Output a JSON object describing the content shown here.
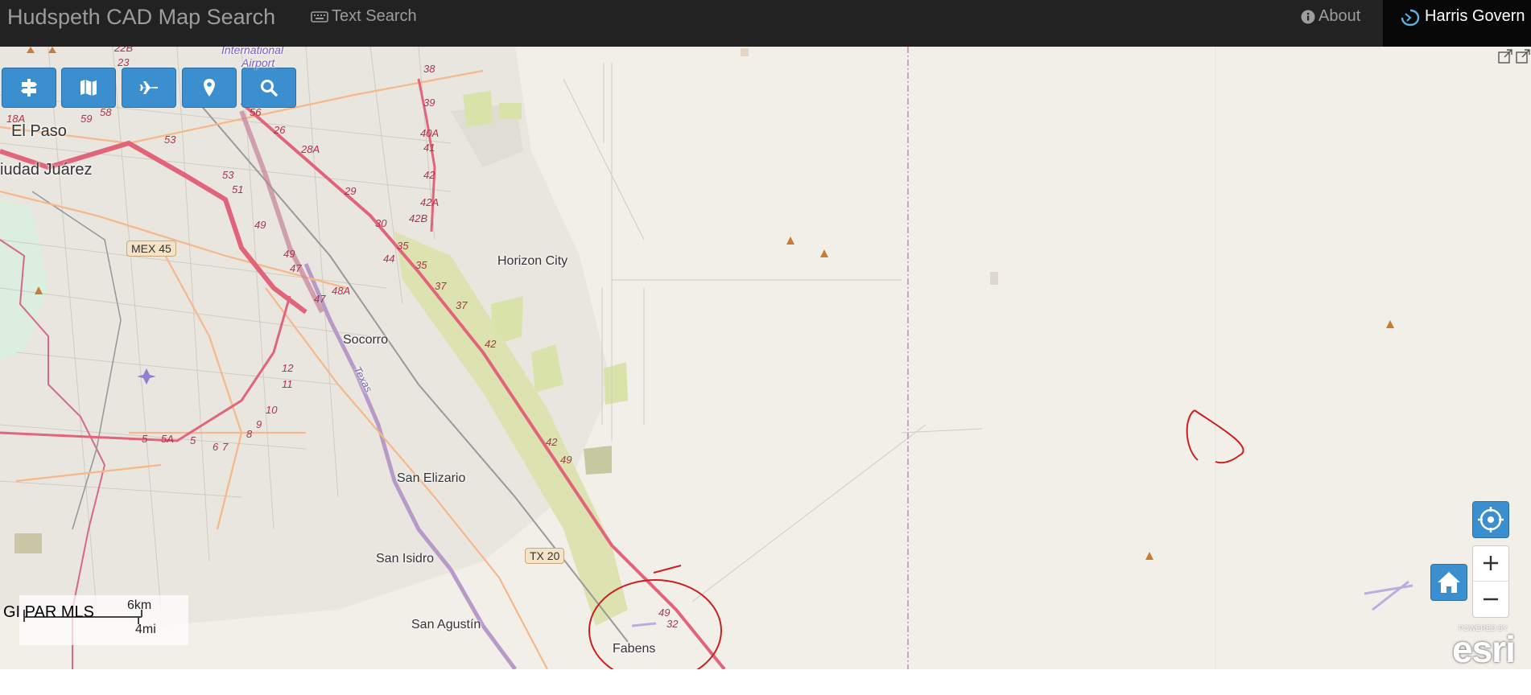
{
  "navbar": {
    "brand": "Hudspeth CAD Map Search",
    "text_search_label": "Text Search",
    "about_label": "About",
    "account_label": "Harris Govern"
  },
  "toolbar": {
    "icons": [
      "signpost-icon",
      "map-icon",
      "airplane-icon",
      "map-marker-icon",
      "search-icon"
    ]
  },
  "map": {
    "places": {
      "el_paso": "El Paso",
      "ciudad_juarez": "iudad Juárez",
      "horizon_city": "Horizon City",
      "socorro": "Socorro",
      "san_elizario": "San Elizario",
      "san_isidro": "San Isidro",
      "san_agustin": "San Agustín",
      "fabens": "Fabens",
      "international_airport_1": "International",
      "international_airport_2": "Airport",
      "texas_canal": "Texas"
    },
    "shields": {
      "mex45": "MEX 45",
      "tx20": "TX 20"
    },
    "exits": [
      "38",
      "39",
      "40A",
      "41",
      "42",
      "42A",
      "42B",
      "35",
      "44",
      "35",
      "37",
      "37",
      "42",
      "42",
      "49",
      "49",
      "32",
      "30",
      "29",
      "28A",
      "26",
      "56",
      "53",
      "53",
      "51",
      "49",
      "49",
      "47",
      "48A",
      "47",
      "12",
      "11",
      "10",
      "9",
      "8",
      "7",
      "6",
      "5",
      "5A",
      "5",
      "59",
      "58",
      "23",
      "22B",
      "18A"
    ],
    "scale": {
      "km_label": "6km",
      "mi_label": "4mi"
    },
    "attribution": "GI PAR MLS",
    "esri_powered": "POWERED BY",
    "esri_logo": "esri"
  },
  "colors": {
    "navbar_bg": "#222222",
    "navbar_text": "#9d9d9d",
    "button_blue": "#3c8fce",
    "map_bg": "#f2efe9",
    "interstate": "#e2647b",
    "annotation_red": "#cc1f1f"
  }
}
